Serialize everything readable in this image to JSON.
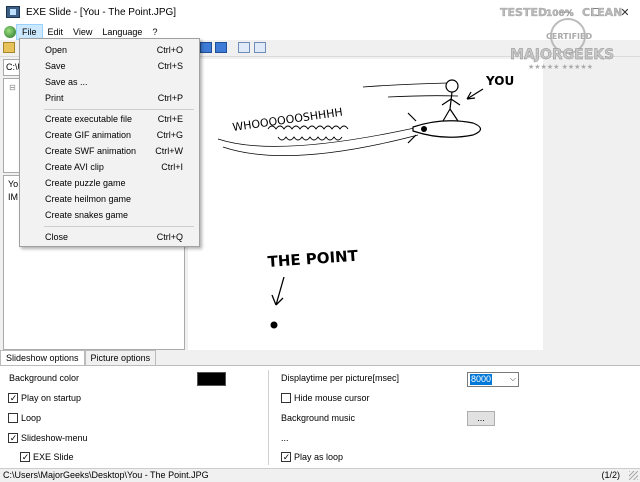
{
  "window": {
    "title": "EXE Slide - [You - The Point.JPG]",
    "controls": [
      "—",
      "☐",
      "✕"
    ]
  },
  "menubar": [
    "File",
    "Edit",
    "View",
    "Language",
    "?"
  ],
  "file_menu": [
    {
      "label": "Open",
      "shortcut": "Ctrl+O"
    },
    {
      "label": "Save",
      "shortcut": "Ctrl+S"
    },
    {
      "label": "Save as ...",
      "shortcut": ""
    },
    {
      "label": "Print",
      "shortcut": "Ctrl+P"
    },
    {
      "label": "Create executable file",
      "shortcut": "Ctrl+E"
    },
    {
      "label": "Create GIF animation",
      "shortcut": "Ctrl+G"
    },
    {
      "label": "Create SWF animation",
      "shortcut": "Ctrl+W"
    },
    {
      "label": "Create AVI clip",
      "shortcut": "Ctrl+I"
    },
    {
      "label": "Create puzzle game",
      "shortcut": ""
    },
    {
      "label": "Create heilmon game",
      "shortcut": ""
    },
    {
      "label": "Create snakes game",
      "shortcut": ""
    },
    {
      "label": "Close",
      "shortcut": "Ctrl+Q"
    }
  ],
  "left_panel": {
    "path": "C:\\U",
    "tree_node": "⊟",
    "file_rows": [
      "Yo",
      "IM"
    ]
  },
  "picture": {
    "texts": {
      "you": "YOU",
      "whoosh": "WHOOOOOOSHHHH",
      "the_point": "THE POINT"
    }
  },
  "tabs": [
    "Slideshow options",
    "Picture options"
  ],
  "options": {
    "background_color_label": "Background color",
    "background_color": "#000000",
    "play_on_startup": {
      "label": "Play on startup",
      "checked": true
    },
    "loop": {
      "label": "Loop",
      "checked": false
    },
    "slideshow_menu": {
      "label": "Slideshow-menu",
      "checked": true
    },
    "exe_slide": {
      "label": "EXE Slide",
      "checked": true
    },
    "displaytime_label": "Displaytime per picture[msec]",
    "displaytime_value": "8000",
    "hide_cursor": {
      "label": "Hide mouse cursor",
      "checked": false
    },
    "background_music_label": "Background music",
    "browse_label": "...",
    "music_value": "...",
    "play_as_loop": {
      "label": "Play as loop",
      "checked": true
    }
  },
  "statusbar": {
    "path": "C:\\Users\\MajorGeeks\\Desktop\\You - The Point.JPG",
    "count": "(1/2)"
  },
  "watermark": {
    "line1": "TESTED",
    "line2": "100%",
    "line3": "CLEAN",
    "line4": "CERTIFIED",
    "line5": "MAJORGEEKS",
    "stars": "★★★★★ ★★★★★"
  }
}
